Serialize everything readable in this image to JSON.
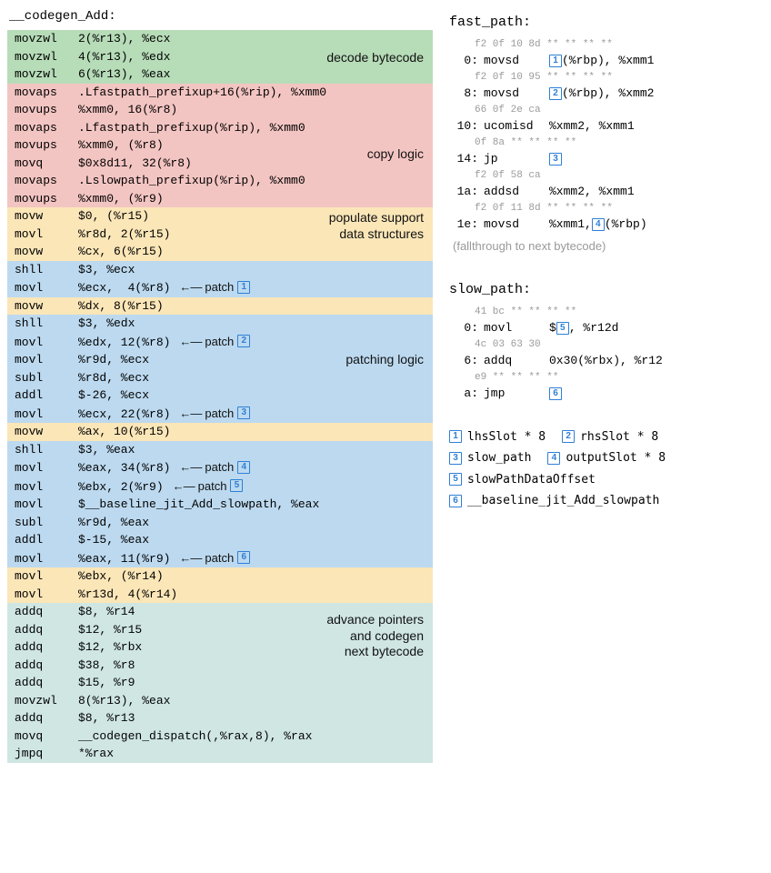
{
  "left_title": "__codegen_Add:",
  "section_labels": {
    "green": "decode bytecode",
    "red": "copy logic",
    "yellow": "populate support\ndata structures",
    "blue": "patching logic",
    "teal": "advance pointers\nand codegen\nnext bytecode"
  },
  "rows": [
    {
      "bg": "green",
      "m": "movzwl",
      "a": "2(%r13), %ecx"
    },
    {
      "bg": "green",
      "m": "movzwl",
      "a": "4(%r13), %edx"
    },
    {
      "bg": "green",
      "m": "movzwl",
      "a": "6(%r13), %eax"
    },
    {
      "bg": "red",
      "m": "movaps",
      "a": ".Lfastpath_prefixup+16(%rip), %xmm0"
    },
    {
      "bg": "red",
      "m": "movups",
      "a": "%xmm0, 16(%r8)"
    },
    {
      "bg": "red",
      "m": "movaps",
      "a": ".Lfastpath_prefixup(%rip), %xmm0"
    },
    {
      "bg": "red",
      "m": "movups",
      "a": "%xmm0, (%r8)"
    },
    {
      "bg": "red",
      "m": "movq",
      "a": "$0x8d11, 32(%r8)"
    },
    {
      "bg": "red",
      "m": "movaps",
      "a": ".Lslowpath_prefixup(%rip), %xmm0"
    },
    {
      "bg": "red",
      "m": "movups",
      "a": "%xmm0, (%r9)"
    },
    {
      "bg": "yellow",
      "m": "movw",
      "a": "$0, (%r15)"
    },
    {
      "bg": "yellow",
      "m": "movl",
      "a": "%r8d, 2(%r15)"
    },
    {
      "bg": "yellow",
      "m": "movw",
      "a": "%cx, 6(%r15)"
    },
    {
      "bg": "blue",
      "m": "shll",
      "a": "$3, %ecx"
    },
    {
      "bg": "blue",
      "m": "movl",
      "a": "%ecx,  4(%r8)",
      "patch": 1
    },
    {
      "bg": "yellow",
      "m": "movw",
      "a": "%dx, 8(%r15)"
    },
    {
      "bg": "blue",
      "m": "shll",
      "a": "$3, %edx"
    },
    {
      "bg": "blue",
      "m": "movl",
      "a": "%edx, 12(%r8)",
      "patch": 2
    },
    {
      "bg": "blue",
      "m": "movl",
      "a": "%r9d, %ecx"
    },
    {
      "bg": "blue",
      "m": "subl",
      "a": "%r8d, %ecx"
    },
    {
      "bg": "blue",
      "m": "addl",
      "a": "$-26, %ecx"
    },
    {
      "bg": "blue",
      "m": "movl",
      "a": "%ecx, 22(%r8)",
      "patch": 3
    },
    {
      "bg": "yellow",
      "m": "movw",
      "a": "%ax, 10(%r15)"
    },
    {
      "bg": "blue",
      "m": "shll",
      "a": "$3, %eax"
    },
    {
      "bg": "blue",
      "m": "movl",
      "a": "%eax, 34(%r8)",
      "patch": 4
    },
    {
      "bg": "blue",
      "m": "movl",
      "a": "%ebx, 2(%r9)",
      "patch": 5
    },
    {
      "bg": "blue",
      "m": "movl",
      "a": "$__baseline_jit_Add_slowpath, %eax"
    },
    {
      "bg": "blue",
      "m": "subl",
      "a": "%r9d, %eax"
    },
    {
      "bg": "blue",
      "m": "addl",
      "a": "$-15, %eax"
    },
    {
      "bg": "blue",
      "m": "movl",
      "a": "%eax, 11(%r9)",
      "patch": 6
    },
    {
      "bg": "yellow",
      "m": "movl",
      "a": "%ebx, (%r14)"
    },
    {
      "bg": "yellow",
      "m": "movl",
      "a": "%r13d, 4(%r14)"
    },
    {
      "bg": "teal",
      "m": "addq",
      "a": "$8, %r14"
    },
    {
      "bg": "teal",
      "m": "addq",
      "a": "$12, %r15"
    },
    {
      "bg": "teal",
      "m": "addq",
      "a": "$12, %rbx"
    },
    {
      "bg": "teal",
      "m": "addq",
      "a": "$38, %r8"
    },
    {
      "bg": "teal",
      "m": "addq",
      "a": "$15, %r9"
    },
    {
      "bg": "teal",
      "m": "movzwl",
      "a": "8(%r13), %eax"
    },
    {
      "bg": "teal",
      "m": "addq",
      "a": "$8, %r13"
    },
    {
      "bg": "teal",
      "m": "movq",
      "a": "__codegen_dispatch(,%rax,8), %rax"
    },
    {
      "bg": "teal",
      "m": "jmpq",
      "a": "*%rax"
    }
  ],
  "patch_word": "patch",
  "fast_path": {
    "title": "fast_path:",
    "lines": [
      {
        "hex": "f2 0f 10 8d ** ** ** **",
        "addr": "0:",
        "m": "movsd",
        "pre": "",
        "box": 1,
        "post": "(%rbp), %xmm1"
      },
      {
        "hex": "f2 0f 10 95 ** ** ** **",
        "addr": "8:",
        "m": "movsd",
        "pre": "",
        "box": 2,
        "post": "(%rbp), %xmm2"
      },
      {
        "hex": "66 0f 2e ca",
        "addr": "10:",
        "m": "ucomisd",
        "args": "%xmm2, %xmm1"
      },
      {
        "hex": "0f 8a ** ** ** **",
        "addr": "14:",
        "m": "jp",
        "pre": "",
        "box": 3,
        "post": ""
      },
      {
        "hex": "f2 0f 58 ca",
        "addr": "1a:",
        "m": "addsd",
        "args": "%xmm2, %xmm1"
      },
      {
        "hex": "f2 0f 11 8d ** ** ** **",
        "addr": "1e:",
        "m": "movsd",
        "pre": "%xmm1,",
        "box": 4,
        "post": "(%rbp)"
      }
    ],
    "fallthrough": "(fallthrough to next bytecode)"
  },
  "slow_path": {
    "title": "slow_path:",
    "lines": [
      {
        "hex": "41 bc ** ** ** **",
        "addr": "0:",
        "m": "movl",
        "pre": "$",
        "box": 5,
        "post": ", %r12d"
      },
      {
        "hex": "4c 03 63 30",
        "addr": "6:",
        "m": "addq",
        "args": "0x30(%rbx), %r12"
      },
      {
        "hex": "e9 ** ** ** **",
        "addr": "a:",
        "m": "jmp",
        "pre": "",
        "box": 6,
        "post": ""
      }
    ]
  },
  "legend": [
    {
      "n": 1,
      "text": "lhsSlot * 8"
    },
    {
      "n": 2,
      "text": "rhsSlot * 8"
    },
    {
      "n": 3,
      "text": "slow_path"
    },
    {
      "n": 4,
      "text": "outputSlot * 8"
    },
    {
      "n": 5,
      "text": "slowPathDataOffset"
    },
    {
      "n": 6,
      "text": "__baseline_jit_Add_slowpath"
    }
  ]
}
